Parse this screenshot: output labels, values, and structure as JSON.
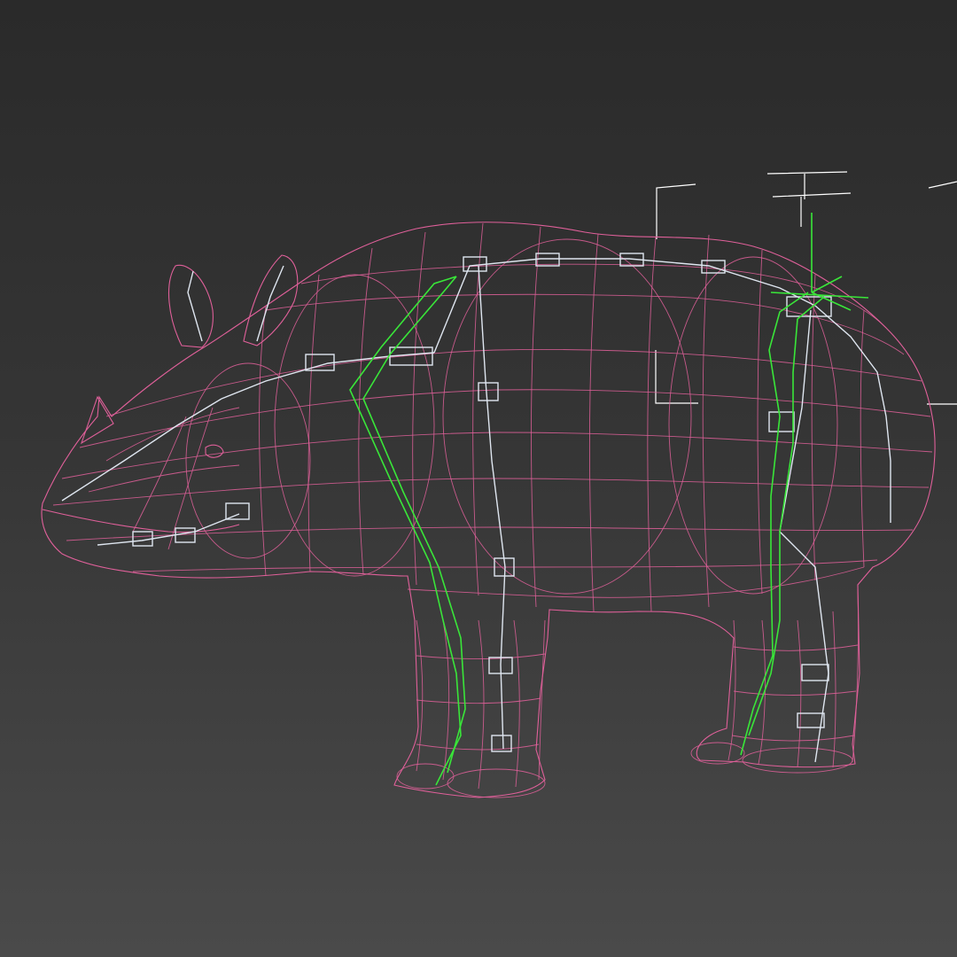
{
  "viewport": {
    "background_top": "#2a2a2a",
    "background_bottom": "#4a4a4a"
  },
  "model": {
    "subject": "rhinoceros",
    "display_mode": "wireframe",
    "mesh_color": "#e0609a",
    "bone_color": "#dfe6f0",
    "ik_chain_color": "#39e639",
    "helper_color": "#ffffff"
  }
}
